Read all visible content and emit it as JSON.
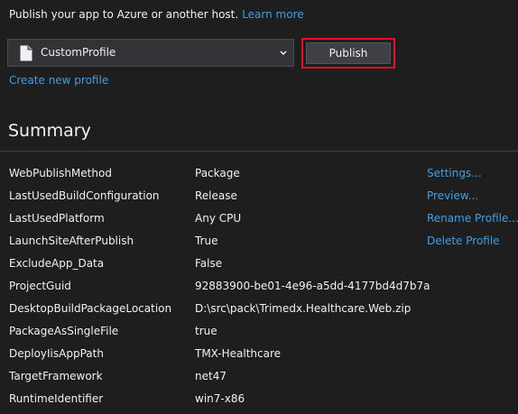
{
  "header": {
    "intro_text": "Publish your app to Azure or another host.",
    "learn_more": "Learn more"
  },
  "profile": {
    "selected": "CustomProfile",
    "publish_label": "Publish",
    "create_new": "Create new profile"
  },
  "summary": {
    "title": "Summary",
    "properties": [
      {
        "name": "WebPublishMethod",
        "value": "Package"
      },
      {
        "name": "LastUsedBuildConfiguration",
        "value": "Release"
      },
      {
        "name": "LastUsedPlatform",
        "value": "Any CPU"
      },
      {
        "name": "LaunchSiteAfterPublish",
        "value": "True"
      },
      {
        "name": "ExcludeApp_Data",
        "value": "False"
      },
      {
        "name": "ProjectGuid",
        "value": "92883900-be01-4e96-a5dd-4177bd4d7b7a"
      },
      {
        "name": "DesktopBuildPackageLocation",
        "value": "D:\\src\\pack\\Trimedx.Healthcare.Web.zip"
      },
      {
        "name": "PackageAsSingleFile",
        "value": "true"
      },
      {
        "name": "DeployIisAppPath",
        "value": "TMX-Healthcare"
      },
      {
        "name": "TargetFramework",
        "value": "net47"
      },
      {
        "name": "RuntimeIdentifier",
        "value": "win7-x86"
      }
    ],
    "actions": [
      "Settings...",
      "Preview...",
      "Rename Profile...",
      "Delete Profile"
    ]
  },
  "colors": {
    "background": "#1e1e1e",
    "link": "#3f9fe6",
    "publish_highlight": "#e81123"
  },
  "icons": {
    "profile": "document-icon",
    "dropdown": "chevron-down-icon"
  }
}
